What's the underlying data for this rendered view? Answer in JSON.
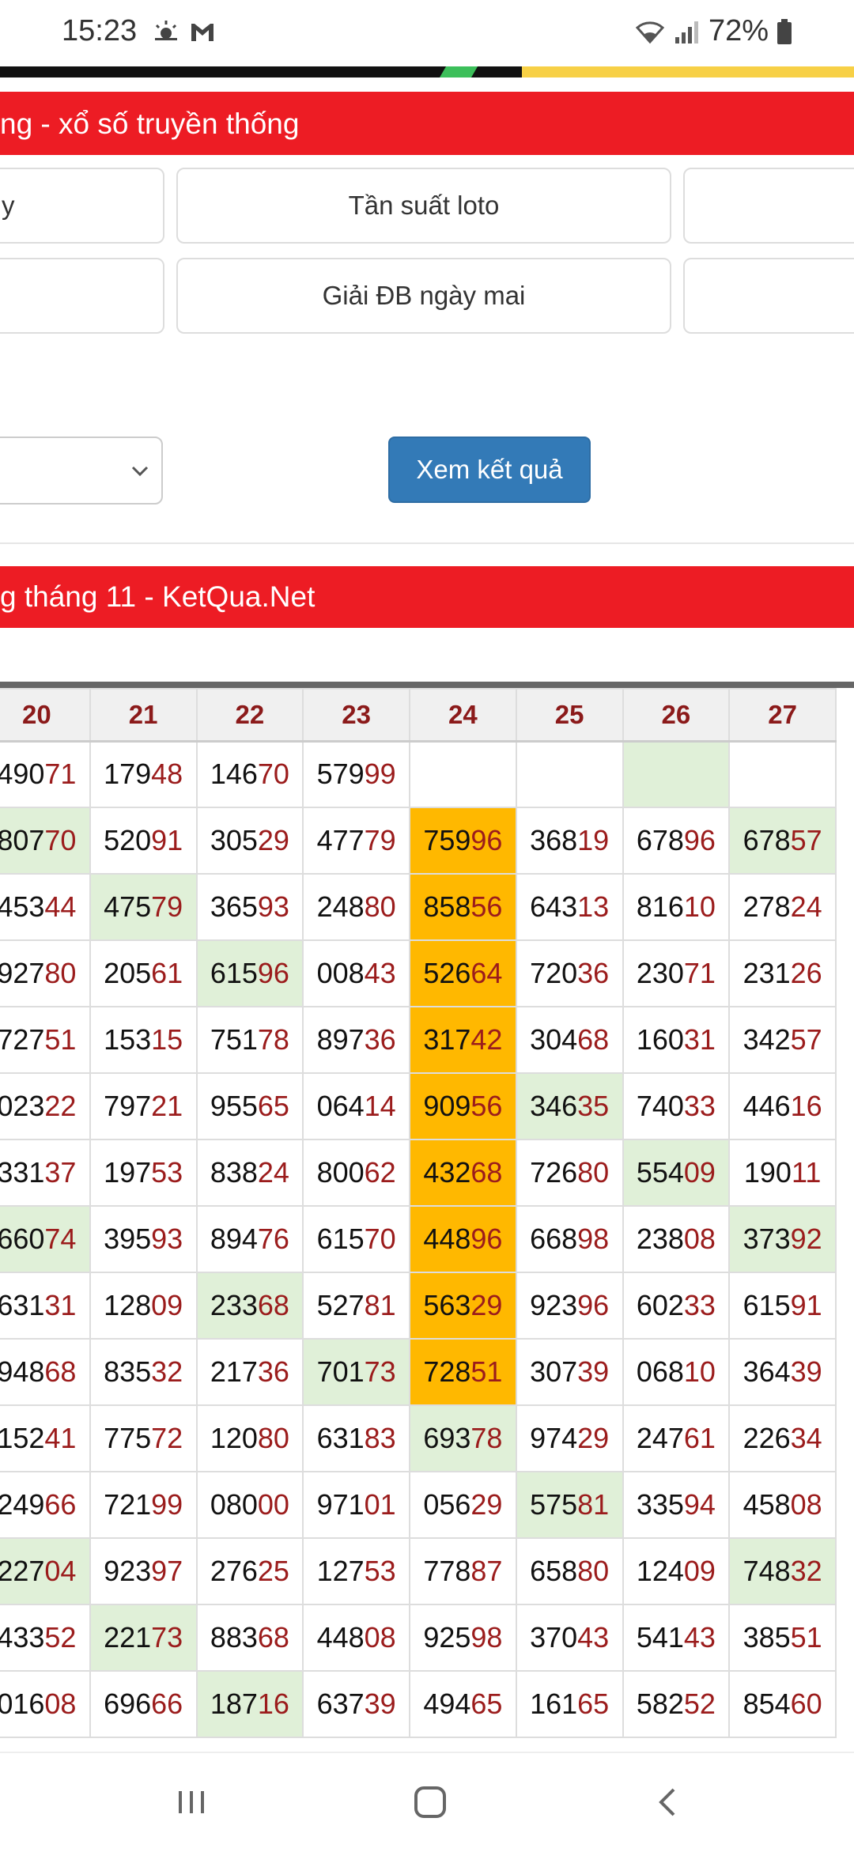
{
  "status_bar": {
    "time": "15:23",
    "battery": "72%"
  },
  "header_title": "ng - xổ số truyền thống",
  "nav_buttons": {
    "left_partial": "y",
    "freq": "Tần suất loto",
    "db_tomorrow": "Giải ĐB ngày mai"
  },
  "form": {
    "submit_label": "Xem kết quả"
  },
  "section_title": "g tháng 11 - KetQua.Net",
  "table": {
    "headers": [
      "20",
      "21",
      "22",
      "23",
      "24",
      "25",
      "26",
      "27"
    ],
    "rows": [
      [
        "49071",
        "17948",
        "14670",
        "57999",
        "",
        "",
        "",
        ""
      ],
      [
        "80770",
        "52091",
        "30529",
        "47779",
        "75996",
        "36819",
        "67896",
        "67857"
      ],
      [
        "45344",
        "47579",
        "36593",
        "24880",
        "85856",
        "64313",
        "81610",
        "27824"
      ],
      [
        "92780",
        "20561",
        "61596",
        "00843",
        "52664",
        "72036",
        "23071",
        "23126"
      ],
      [
        "72751",
        "15315",
        "75178",
        "89736",
        "31742",
        "30468",
        "16031",
        "34257"
      ],
      [
        "02322",
        "79721",
        "95565",
        "06414",
        "90956",
        "34635",
        "74033",
        "44616"
      ],
      [
        "33137",
        "19753",
        "83824",
        "80062",
        "43268",
        "72680",
        "55409",
        "19011"
      ],
      [
        "66074",
        "39593",
        "89476",
        "61570",
        "44896",
        "66898",
        "23808",
        "37392"
      ],
      [
        "63131",
        "12809",
        "23368",
        "52781",
        "56329",
        "92396",
        "60233",
        "61591"
      ],
      [
        "94868",
        "83532",
        "21736",
        "70173",
        "72851",
        "30739",
        "06810",
        "36439"
      ],
      [
        "15241",
        "77572",
        "12080",
        "63183",
        "69378",
        "97429",
        "24761",
        "22634"
      ],
      [
        "24966",
        "72199",
        "08000",
        "97101",
        "05629",
        "57581",
        "33594",
        "45808"
      ],
      [
        "22704",
        "92397",
        "27625",
        "12753",
        "77887",
        "65880",
        "12409",
        "74832"
      ],
      [
        "43352",
        "22173",
        "88368",
        "44808",
        "92598",
        "37043",
        "54143",
        "38551"
      ],
      [
        "01608",
        "69666",
        "18716",
        "63739",
        "49465",
        "16165",
        "58252",
        "85460"
      ]
    ],
    "green_cells": [
      [
        0,
        6
      ],
      [
        1,
        0
      ],
      [
        1,
        7
      ],
      [
        2,
        1
      ],
      [
        3,
        2
      ],
      [
        5,
        5
      ],
      [
        6,
        6
      ],
      [
        7,
        0
      ],
      [
        7,
        7
      ],
      [
        8,
        2
      ],
      [
        9,
        3
      ],
      [
        10,
        4
      ],
      [
        11,
        5
      ],
      [
        12,
        0
      ],
      [
        12,
        7
      ],
      [
        13,
        1
      ],
      [
        14,
        2
      ]
    ],
    "orange_cells": [
      [
        1,
        4
      ],
      [
        2,
        4
      ],
      [
        3,
        4
      ],
      [
        4,
        4
      ],
      [
        5,
        4
      ],
      [
        6,
        4
      ],
      [
        7,
        4
      ],
      [
        8,
        4
      ],
      [
        9,
        4
      ]
    ],
    "colors": {
      "highlight_green": "#e0f0d8",
      "highlight_orange": "#ffb800",
      "tail_red": "#9b1c1c",
      "header_red": "#ed1c24",
      "button_blue": "#337ab7"
    }
  }
}
